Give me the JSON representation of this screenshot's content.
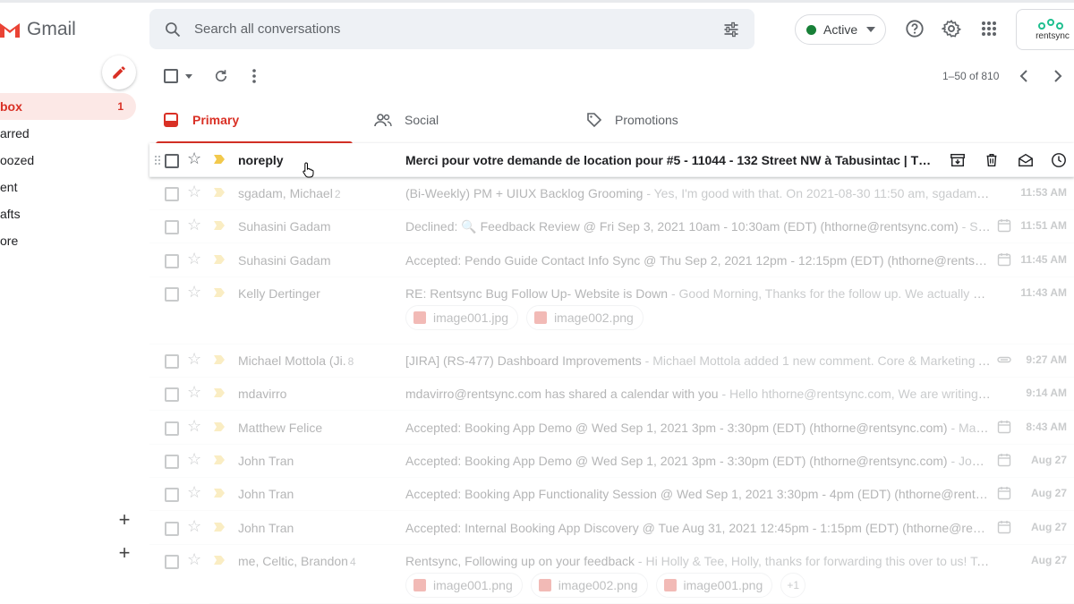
{
  "app": {
    "name": "Gmail"
  },
  "search": {
    "placeholder": "Search all conversations"
  },
  "status": {
    "label": "Active",
    "color": "#188038"
  },
  "brand": {
    "name": "rentsync"
  },
  "nav": {
    "items": [
      {
        "label": "box",
        "count": "1",
        "active": true
      },
      {
        "label": "arred"
      },
      {
        "label": "oozed"
      },
      {
        "label": "ent"
      },
      {
        "label": "afts"
      },
      {
        "label": "ore"
      }
    ]
  },
  "toolbar": {
    "pager": "1–50 of 810"
  },
  "tabs": [
    {
      "label": "Primary",
      "icon": "inbox-icon"
    },
    {
      "label": "Social",
      "icon": "people-icon"
    },
    {
      "label": "Promotions",
      "icon": "tag-icon"
    }
  ],
  "emails": [
    {
      "sender": "noreply",
      "count": "",
      "subject": "Merci pour votre demande de location pour #5 - 11044 - 132 Street NW à Tabusintac | Thank yo...",
      "snippet": "",
      "date": ""
    },
    {
      "sender": "sgadam, Michael",
      "count": "2",
      "subject": "(Bi-Weekly) PM + UIUX Backlog Grooming",
      "snippet": " - Yes, I'm good with that. On 2021-08-30 11:50 am, sgadam@rent...",
      "date": "11:53 AM"
    },
    {
      "sender": "Suhasini Gadam",
      "count": "",
      "subject": "Declined: 🔍 Feedback Review @ Fri Sep 3, 2021 10am - 10:30am (EDT) (hthorne@rentsync.com)",
      "snippet": " - Suhasini...",
      "date": "11:51 AM"
    },
    {
      "sender": "Suhasini Gadam",
      "count": "",
      "subject": "Accepted: Pendo Guide Contact Info Sync @ Thu Sep 2, 2021 12pm - 12:15pm (EDT) (hthorne@rentsync.co...",
      "snippet": "",
      "date": "11:45 AM"
    },
    {
      "sender": "Kelly Dertinger",
      "count": "",
      "subject": "RE: Rentsync Bug Follow Up- Website is Down",
      "snippet": " - Good Morning, Thanks for the follow up. We actually have a ...",
      "date": "11:43 AM",
      "attachments": [
        "image001.jpg",
        "image002.png"
      ]
    },
    {
      "sender": "Michael Mottola (Ji.",
      "count": "8",
      "subject": "[JIRA] (RS-477) Dashboard Improvements",
      "snippet": " - Michael Mottola added 1 new comment. Core & Marketing Auto...",
      "date": "9:27 AM"
    },
    {
      "sender": "mdavirro",
      "count": "",
      "subject": "mdavirro@rentsync.com has shared a calendar with you",
      "snippet": " - Hello hthorne@rentsync.com, We are writing to le...",
      "date": "9:14 AM"
    },
    {
      "sender": "Matthew Felice",
      "count": "",
      "subject": "Accepted: Booking App Demo @ Wed Sep 1, 2021 3pm - 3:30pm (EDT) (hthorne@rentsync.com)",
      "snippet": " - Matthew ...",
      "date": "8:43 AM"
    },
    {
      "sender": "John Tran",
      "count": "",
      "subject": "Accepted: Booking App Demo @ Wed Sep 1, 2021 3pm - 3:30pm (EDT) (hthorne@rentsync.com)",
      "snippet": " - John Tran...",
      "date": "Aug 27"
    },
    {
      "sender": "John Tran",
      "count": "",
      "subject": "Accepted: Booking App Functionality Session @ Wed Sep 1, 2021 3:30pm - 4pm (EDT) (hthorne@rentsync.c...",
      "snippet": "",
      "date": "Aug 27"
    },
    {
      "sender": "John Tran",
      "count": "",
      "subject": "Accepted: Internal Booking App Discovery @ Tue Aug 31, 2021 12:45pm - 1:15pm (EDT) (hthorne@rentsync....",
      "snippet": "",
      "date": "Aug 27"
    },
    {
      "sender": "me, Celtic, Brandon",
      "count": "4",
      "subject": "Rentsync, Following up on your feedback",
      "snippet": " - Hi Holly & Tee, Holly, thanks for forwarding this over to us! Tee, I ...",
      "date": "Aug 27",
      "attachments": [
        "image001.png",
        "image002.png",
        "image001.png"
      ],
      "more": "+1"
    }
  ]
}
